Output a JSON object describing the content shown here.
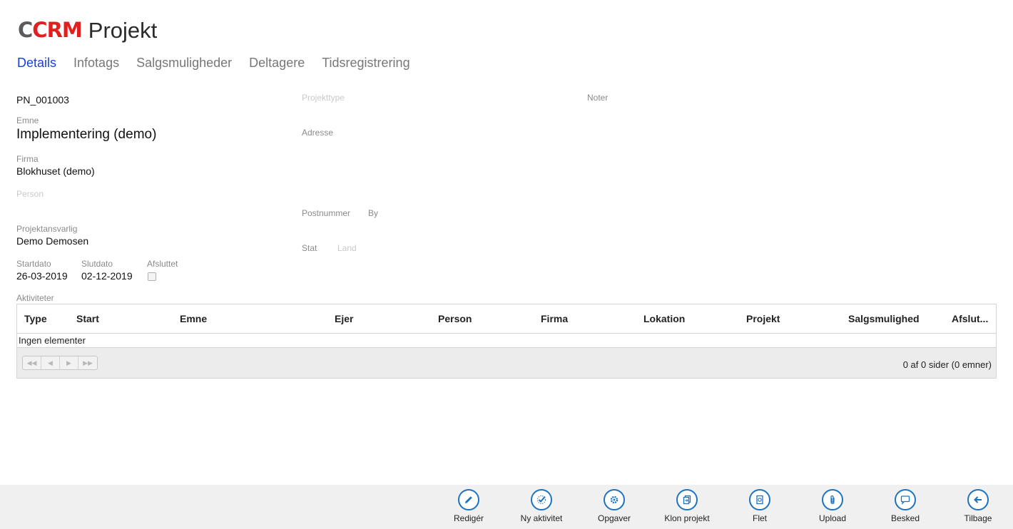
{
  "header": {
    "logo_c": "C",
    "logo_crm": "CRM",
    "title": "Projekt"
  },
  "tabs": [
    {
      "label": "Details",
      "active": true
    },
    {
      "label": "Infotags",
      "active": false
    },
    {
      "label": "Salgsmuligheder",
      "active": false
    },
    {
      "label": "Deltagere",
      "active": false
    },
    {
      "label": "Tidsregistrering",
      "active": false
    }
  ],
  "details": {
    "project_number": "PN_001003",
    "emne_label": "Emne",
    "emne_value": "Implementering (demo)",
    "firma_label": "Firma",
    "firma_value": "Blokhuset (demo)",
    "person_label": "Person",
    "ansvarlig_label": "Projektansvarlig",
    "ansvarlig_value": "Demo Demosen",
    "startdato_label": "Startdato",
    "startdato_value": "26-03-2019",
    "slutdato_label": "Slutdato",
    "slutdato_value": "02-12-2019",
    "afsluttet_label": "Afsluttet",
    "projekttype_label": "Projekttype",
    "adresse_label": "Adresse",
    "postnummer_label": "Postnummer",
    "by_label": "By",
    "stat_label": "Stat",
    "land_label": "Land",
    "noter_label": "Noter"
  },
  "activities": {
    "label": "Aktiviteter",
    "columns": [
      "Type",
      "Start",
      "Emne",
      "Ejer",
      "Person",
      "Firma",
      "Lokation",
      "Projekt",
      "Salgsmulighed",
      "Afslut..."
    ],
    "empty_text": "Ingen elementer",
    "pager_info": "0 af 0 sider (0 emner)"
  },
  "actions": [
    {
      "label": "Redigér",
      "icon": "pencil-icon"
    },
    {
      "label": "Ny aktivitet",
      "icon": "checkmark-icon"
    },
    {
      "label": "Opgaver",
      "icon": "gear-icon"
    },
    {
      "label": "Klon projekt",
      "icon": "clone-document-icon"
    },
    {
      "label": "Flet",
      "icon": "merge-document-icon"
    },
    {
      "label": "Upload",
      "icon": "paperclip-icon"
    },
    {
      "label": "Besked",
      "icon": "message-bubble-icon"
    },
    {
      "label": "Tilbage",
      "icon": "arrow-left-icon"
    }
  ],
  "colors": {
    "accent": "#1e73be",
    "active_tab": "#1a3fd6",
    "logo_red": "#e02020",
    "logo_gray": "#5b5b5b"
  }
}
